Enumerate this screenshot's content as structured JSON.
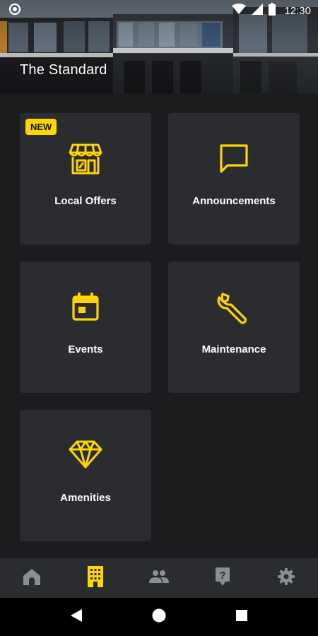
{
  "status_bar": {
    "time": "12:30"
  },
  "header": {
    "title": "The Standard"
  },
  "tiles": [
    {
      "label": "Local Offers",
      "badge": "NEW"
    },
    {
      "label": "Announcements"
    },
    {
      "label": "Events"
    },
    {
      "label": "Maintenance"
    },
    {
      "label": "Amenities"
    }
  ],
  "tab_bar": {
    "items": [
      "home-icon",
      "building-icon",
      "people-icon",
      "help-icon",
      "gear-icon"
    ],
    "active_index": 1
  },
  "colors": {
    "accent": "#ffd500",
    "background": "#1b1c1e",
    "tile": "#2b2c2f",
    "inactive_icon": "#8b8e93"
  }
}
